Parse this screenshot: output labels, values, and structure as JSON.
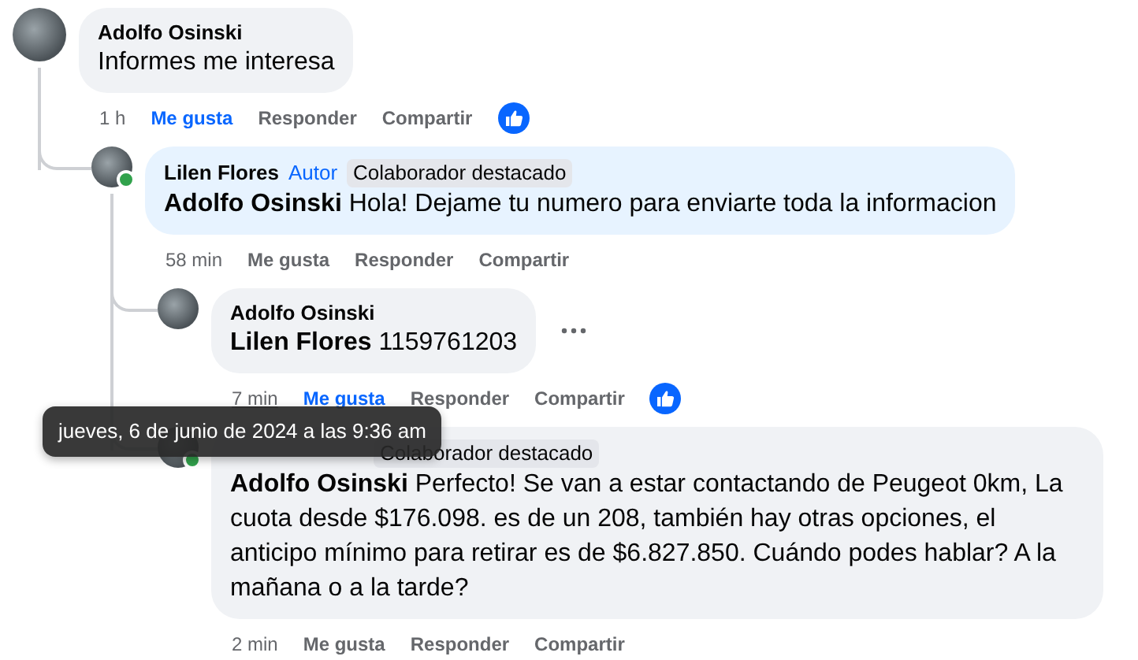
{
  "comments": [
    {
      "author": "Adolfo Osinski",
      "body": "Informes me interesa",
      "time": "1 h",
      "time_hovered": false,
      "liked": true,
      "actions": [
        "Me gusta",
        "Responder",
        "Compartir"
      ],
      "replies": [
        {
          "author": "Lilen Flores",
          "author_label": "Autor",
          "badges": [
            "Colaborador destacado"
          ],
          "body": "**Adolfo Osinski** Hola! Dejame tu numero para enviarte toda la informacion",
          "online": true,
          "time": "58 min",
          "time_hovered": false,
          "liked": false,
          "actions": [
            "Me gusta",
            "Responder",
            "Compartir"
          ],
          "replies": [
            {
              "author": "Adolfo Osinski",
              "body": "**Lilen Flores** 1159761203",
              "time": "7 min",
              "time_hovered": true,
              "liked": true,
              "actions": [
                "Me gusta",
                "Responder",
                "Compartir"
              ],
              "show_menu": true
            },
            {
              "badges": [
                "Colaborador destacado"
              ],
              "body": "**Adolfo Osinski** Perfecto! Se van a estar contactando de Peugeot 0km, La cuota desde $176.098. es de un 208, también hay otras opciones, el anticipo mínimo para retirar es de $6.827.850. Cuándo podes hablar? A la mañana o a la tarde?",
              "online": true,
              "time": "2 min",
              "time_hovered": false,
              "liked": false,
              "actions": [
                "Me gusta",
                "Responder",
                "Compartir"
              ]
            }
          ]
        }
      ]
    }
  ],
  "tooltip": {
    "text": "jueves, 6 de junio de 2024 a las 9:36 am"
  }
}
